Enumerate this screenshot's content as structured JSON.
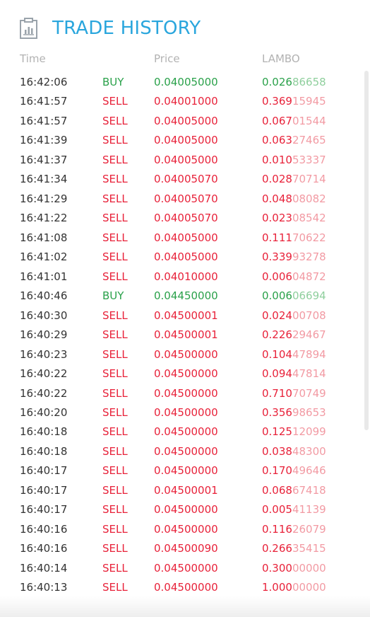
{
  "header": {
    "title": "TRADE HISTORY",
    "icon": "chart-document-icon"
  },
  "columns": {
    "time": "Time",
    "price": "Price",
    "amount": "LAMBO"
  },
  "colors": {
    "title": "#2aa6dd",
    "buy": "#2aa14a",
    "sell": "#e8223a"
  },
  "trades": [
    {
      "time": "16:42:06",
      "side": "BUY",
      "price": "0.04005000",
      "amount_strong": "0.026",
      "amount_light": "86658"
    },
    {
      "time": "16:41:57",
      "side": "SELL",
      "price": "0.04001000",
      "amount_strong": "0.369",
      "amount_light": "15945"
    },
    {
      "time": "16:41:57",
      "side": "SELL",
      "price": "0.04005000",
      "amount_strong": "0.067",
      "amount_light": "01544"
    },
    {
      "time": "16:41:39",
      "side": "SELL",
      "price": "0.04005000",
      "amount_strong": "0.063",
      "amount_light": "27465"
    },
    {
      "time": "16:41:37",
      "side": "SELL",
      "price": "0.04005000",
      "amount_strong": "0.010",
      "amount_light": "53337"
    },
    {
      "time": "16:41:34",
      "side": "SELL",
      "price": "0.04005070",
      "amount_strong": "0.028",
      "amount_light": "70714"
    },
    {
      "time": "16:41:29",
      "side": "SELL",
      "price": "0.04005070",
      "amount_strong": "0.048",
      "amount_light": "08082"
    },
    {
      "time": "16:41:22",
      "side": "SELL",
      "price": "0.04005070",
      "amount_strong": "0.023",
      "amount_light": "08542"
    },
    {
      "time": "16:41:08",
      "side": "SELL",
      "price": "0.04005000",
      "amount_strong": "0.111",
      "amount_light": "70622"
    },
    {
      "time": "16:41:02",
      "side": "SELL",
      "price": "0.04005000",
      "amount_strong": "0.339",
      "amount_light": "93278"
    },
    {
      "time": "16:41:01",
      "side": "SELL",
      "price": "0.04010000",
      "amount_strong": "0.006",
      "amount_light": "04872"
    },
    {
      "time": "16:40:46",
      "side": "BUY",
      "price": "0.04450000",
      "amount_strong": "0.006",
      "amount_light": "06694"
    },
    {
      "time": "16:40:30",
      "side": "SELL",
      "price": "0.04500001",
      "amount_strong": "0.024",
      "amount_light": "00708"
    },
    {
      "time": "16:40:29",
      "side": "SELL",
      "price": "0.04500001",
      "amount_strong": "0.226",
      "amount_light": "29467"
    },
    {
      "time": "16:40:23",
      "side": "SELL",
      "price": "0.04500000",
      "amount_strong": "0.104",
      "amount_light": "47894"
    },
    {
      "time": "16:40:22",
      "side": "SELL",
      "price": "0.04500000",
      "amount_strong": "0.094",
      "amount_light": "47814"
    },
    {
      "time": "16:40:22",
      "side": "SELL",
      "price": "0.04500000",
      "amount_strong": "0.710",
      "amount_light": "70749"
    },
    {
      "time": "16:40:20",
      "side": "SELL",
      "price": "0.04500000",
      "amount_strong": "0.356",
      "amount_light": "98653"
    },
    {
      "time": "16:40:18",
      "side": "SELL",
      "price": "0.04500000",
      "amount_strong": "0.125",
      "amount_light": "12099"
    },
    {
      "time": "16:40:18",
      "side": "SELL",
      "price": "0.04500000",
      "amount_strong": "0.038",
      "amount_light": "48300"
    },
    {
      "time": "16:40:17",
      "side": "SELL",
      "price": "0.04500000",
      "amount_strong": "0.170",
      "amount_light": "49646"
    },
    {
      "time": "16:40:17",
      "side": "SELL",
      "price": "0.04500001",
      "amount_strong": "0.068",
      "amount_light": "67418"
    },
    {
      "time": "16:40:17",
      "side": "SELL",
      "price": "0.04500000",
      "amount_strong": "0.005",
      "amount_light": "41139"
    },
    {
      "time": "16:40:16",
      "side": "SELL",
      "price": "0.04500000",
      "amount_strong": "0.116",
      "amount_light": "26079"
    },
    {
      "time": "16:40:16",
      "side": "SELL",
      "price": "0.04500090",
      "amount_strong": "0.266",
      "amount_light": "35415"
    },
    {
      "time": "16:40:14",
      "side": "SELL",
      "price": "0.04500000",
      "amount_strong": "0.300",
      "amount_light": "00000"
    },
    {
      "time": "16:40:13",
      "side": "SELL",
      "price": "0.04500000",
      "amount_strong": "1.000",
      "amount_light": "00000"
    }
  ]
}
